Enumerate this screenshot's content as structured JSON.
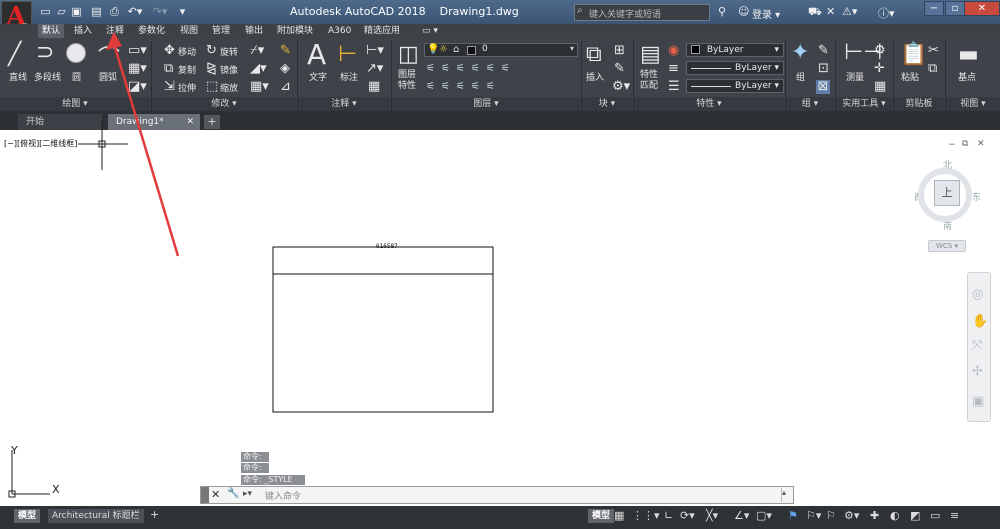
{
  "app": {
    "title": "Autodesk AutoCAD 2018",
    "document": "Drawing1.dwg",
    "logo_letter": "A",
    "search_placeholder": "键入关键字或短语",
    "login_label": "登录"
  },
  "ribbon_tabs": [
    "默认",
    "插入",
    "注释",
    "参数化",
    "视图",
    "管理",
    "输出",
    "附加模块",
    "A360",
    "精选应用"
  ],
  "panels": {
    "draw": {
      "title": "绘图 ▾",
      "tools": [
        "直线",
        "多段线",
        "圆",
        "圆弧"
      ]
    },
    "modify": {
      "title": "修改 ▾",
      "tools": [
        "移动",
        "旋转",
        "复制",
        "镜像",
        "拉伸",
        "缩放"
      ]
    },
    "annotation": {
      "title": "注释 ▾",
      "tools": [
        "文字",
        "标注"
      ]
    },
    "layers": {
      "title": "图层 ▾",
      "tools": [
        "图层特性"
      ],
      "current_layer": "0"
    },
    "block": {
      "title": "块 ▾",
      "tools": [
        "插入"
      ]
    },
    "properties": {
      "title": "特性 ▾",
      "tools": [
        "特性匹配"
      ],
      "color": "ByLayer",
      "linetype": "ByLayer",
      "lineweight": "ByLayer"
    },
    "groups": {
      "title": "组 ▾",
      "tools": [
        "组"
      ]
    },
    "utilities": {
      "title": "实用工具 ▾",
      "tools": [
        "测量"
      ]
    },
    "clipboard": {
      "title": "剪贴板",
      "tools": [
        "粘贴"
      ]
    },
    "view": {
      "title": "视图 ▾",
      "tools": [
        "基点"
      ]
    }
  },
  "file_tabs": [
    "开始",
    "Drawing1*"
  ],
  "viewport": {
    "label": "[−][俯视][二维线框]",
    "viewcube_face": "上",
    "compass": {
      "north": "北",
      "south": "南",
      "east": "东",
      "west": "西"
    },
    "ucs_label": "WCS ▾",
    "ucs_axes": {
      "x": "X",
      "y": "Y"
    },
    "drawing_text": "616587"
  },
  "command_history": [
    "命令:",
    "命令:",
    "命令: _STYLE"
  ],
  "command_input_placeholder": "键入命令",
  "status": {
    "layout_tabs": [
      "模型",
      "Architectural 标题栏"
    ],
    "mode_label": "模型"
  },
  "colors": {
    "ribbon_bg": "#3f4349",
    "titlebar": "#4e6a8c",
    "app_logo": "#e02424",
    "annotation_arrow": "#e23b3b"
  }
}
